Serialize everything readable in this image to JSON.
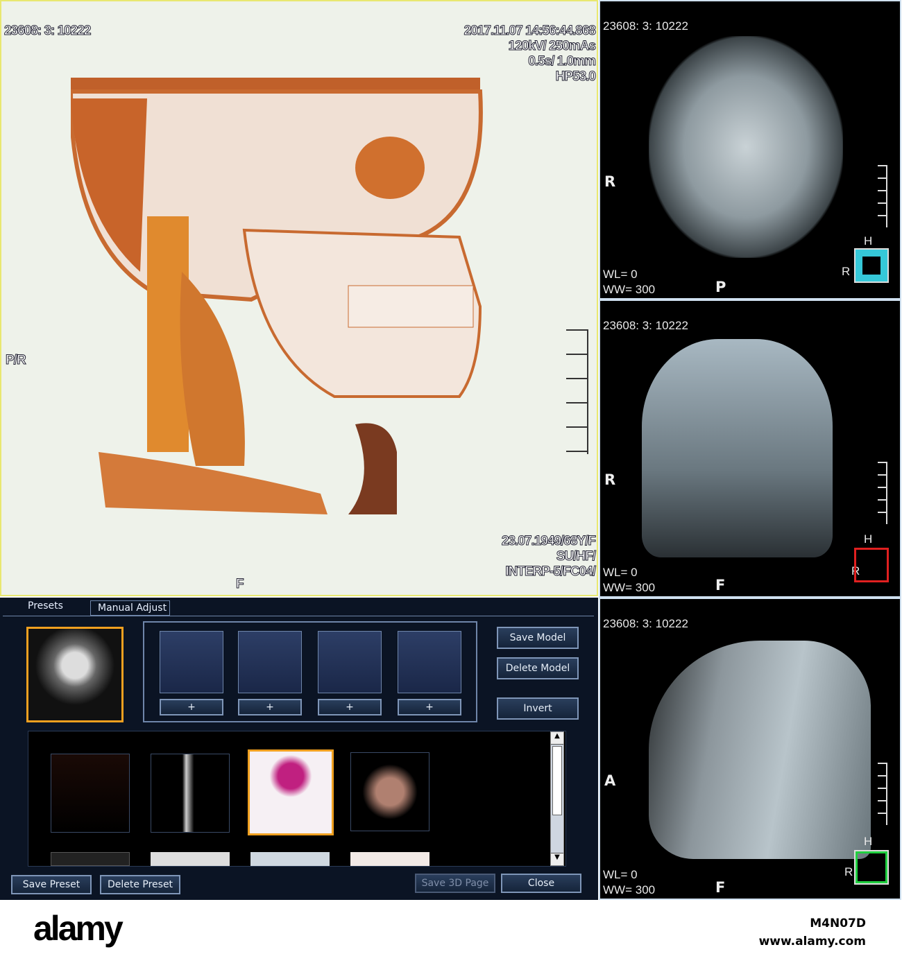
{
  "main_view": {
    "id_text": "23608: 3: 10222",
    "datetime": "2017.11.07 14:56:44.868",
    "exposure": "120kV/ 250mAs",
    "slice": "0.5s/ 1.0mm",
    "hp": "HP53.0",
    "orientation_left": "P/R",
    "orientation_bottom": "F",
    "patient_dob": "23.07.1949/68Y/F",
    "position": "SU/HF/",
    "interp": "INTERP-5/FC04/"
  },
  "viewports": [
    {
      "name": "axial",
      "id_text": "23608: 3: 10222",
      "left_label": "R",
      "bottom_label": "P",
      "wl": "WL= 0",
      "ww": "WW= 300",
      "cube_top": "H",
      "cube_side": "R",
      "accent": "#35c8d8"
    },
    {
      "name": "coronal",
      "id_text": "23608: 3: 10222",
      "left_label": "R",
      "bottom_label": "F",
      "wl": "WL= 0",
      "ww": "WW= 300",
      "cube_top": "H",
      "cube_side": "R",
      "accent": "#e02020"
    },
    {
      "name": "sagittal",
      "id_text": "23608: 3: 10222",
      "left_label": "A",
      "bottom_label": "F",
      "wl": "WL= 0",
      "ww": "WW= 300",
      "cube_top": "H",
      "cube_side": "R",
      "accent": "#20d040"
    }
  ],
  "control_panel": {
    "tabs": [
      "Presets",
      "Manual Adjust"
    ],
    "slot_add_label": "+",
    "buttons": {
      "save_model": "Save Model",
      "delete_model": "Delete Model",
      "invert": "Invert",
      "save_preset": "Save Preset",
      "delete_preset": "Delete Preset",
      "save_3d_page": "Save 3D Page",
      "close": "Close"
    }
  },
  "footer": {
    "logo": "alamy",
    "image_id": "M4N07D",
    "url": "www.alamy.com"
  }
}
